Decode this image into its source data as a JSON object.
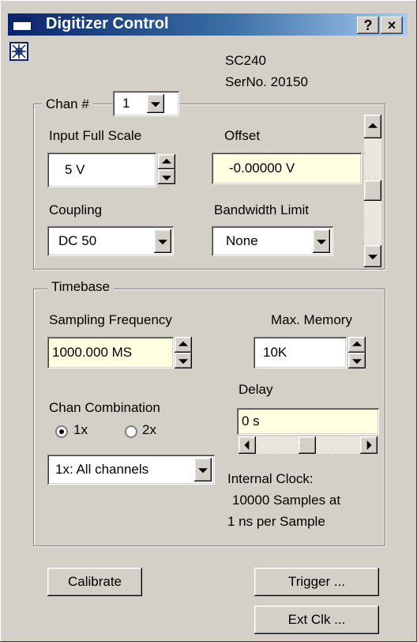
{
  "window": {
    "title": "Digitizer Control",
    "help_glyph": "?",
    "close_glyph": "×"
  },
  "device": {
    "model": "SC240",
    "serial": "SerNo. 20150"
  },
  "channel": {
    "legend": "Chan #",
    "selected": "1",
    "input_full_scale_label": "Input Full Scale",
    "input_full_scale_value": "5 V",
    "offset_label": "Offset",
    "offset_value": "-0.00000 V",
    "coupling_label": "Coupling",
    "coupling_value": "DC 50",
    "bandwidth_label": "Bandwidth Limit",
    "bandwidth_value": "None"
  },
  "timebase": {
    "legend": "Timebase",
    "sampling_label": "Sampling Frequency",
    "sampling_value": "1000.000 MS",
    "max_memory_label": "Max. Memory",
    "max_memory_value": "10K",
    "delay_label": "Delay",
    "delay_value": "0 s",
    "chan_combination_label": "Chan Combination",
    "radio_1x": "1x",
    "radio_2x": "2x",
    "combination_value": "1x: All channels",
    "clock_line1": "Internal Clock:",
    "clock_line2": "10000 Samples at",
    "clock_line3": "1 ns per Sample"
  },
  "buttons": {
    "calibrate": "Calibrate",
    "trigger": "Trigger ...",
    "ext_clk": "Ext Clk ..."
  },
  "colors": {
    "face": "#d4d0c8",
    "title_start": "#0a246a",
    "title_end": "#a6caf0",
    "highlight_field": "#ffffe1"
  }
}
